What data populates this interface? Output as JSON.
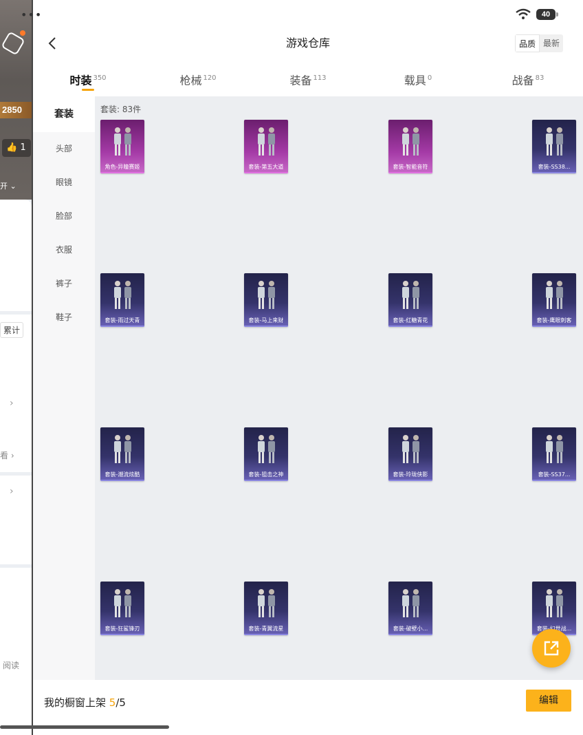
{
  "background_screen": {
    "score": "2850",
    "likes": "1",
    "expand_label": "开",
    "tag_label": "累计",
    "view_label": "看",
    "read_label": "阅读"
  },
  "status_bar": {
    "battery": "40"
  },
  "header": {
    "title": "游戏仓库",
    "sort_options": [
      "品质",
      "最新"
    ]
  },
  "tabs": [
    {
      "label": "时装",
      "count": "350",
      "active": true
    },
    {
      "label": "枪械",
      "count": "120",
      "active": false
    },
    {
      "label": "装备",
      "count": "113",
      "active": false
    },
    {
      "label": "载具",
      "count": "0",
      "active": false
    },
    {
      "label": "战备",
      "count": "83",
      "active": false
    }
  ],
  "sidebar": {
    "items": [
      "套装",
      "头部",
      "眼镜",
      "脸部",
      "衣服",
      "裤子",
      "鞋子"
    ],
    "active_index": 0
  },
  "content": {
    "caption": "套装: 83件",
    "items": [
      {
        "name": "角色-异瞳赛姬",
        "rarity": "purple"
      },
      {
        "name": "套装-第五大道",
        "rarity": "purple"
      },
      {
        "name": "套装-智能音符",
        "rarity": "purple"
      },
      {
        "name": "套装-SS38...",
        "rarity": "blue"
      },
      {
        "name": "套装-雨过天青",
        "rarity": "blue"
      },
      {
        "name": "套装-马上来财",
        "rarity": "blue"
      },
      {
        "name": "套装-红糖青花",
        "rarity": "blue"
      },
      {
        "name": "套装-鹰眼刺客",
        "rarity": "blue"
      },
      {
        "name": "套装-潮流炫酷",
        "rarity": "blue"
      },
      {
        "name": "套装-狙击之神",
        "rarity": "blue"
      },
      {
        "name": "套装-玲珑侠影",
        "rarity": "blue"
      },
      {
        "name": "套装-SS37...",
        "rarity": "blue"
      },
      {
        "name": "套装-狂鲨锋刃",
        "rarity": "blue"
      },
      {
        "name": "套装-青翼流星",
        "rarity": "blue"
      },
      {
        "name": "套装-破壁小...",
        "rarity": "blue"
      },
      {
        "name": "套装-幻世战...",
        "rarity": "blue"
      }
    ]
  },
  "footer": {
    "label": "我的橱窗上架",
    "current": "5",
    "total": "/5",
    "edit_label": "编辑"
  },
  "colors": {
    "accent": "#fcb21b",
    "purple_rarity": "#a43aa6",
    "blue_rarity": "#34336a"
  }
}
